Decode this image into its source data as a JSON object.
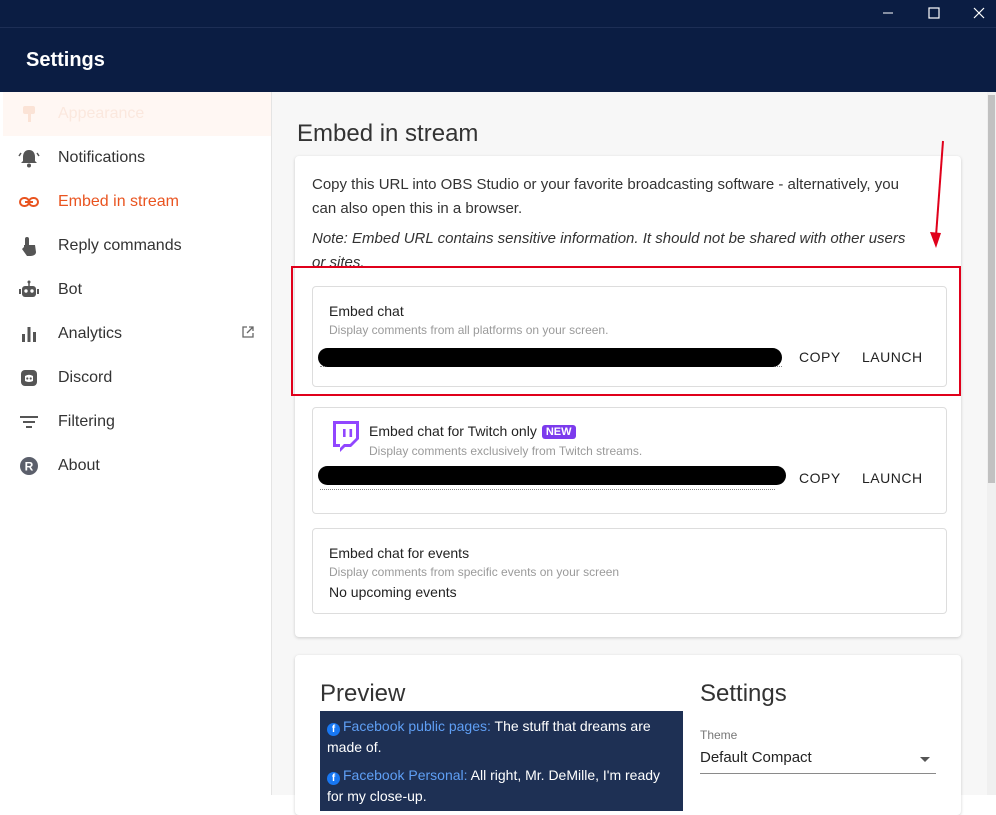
{
  "window": {
    "title": "Settings",
    "controls": [
      "minimize-icon",
      "maximize-icon",
      "close-icon"
    ]
  },
  "sidebar": {
    "items": [
      {
        "label": "Appearance",
        "icon": "paint-icon",
        "state": "faded"
      },
      {
        "label": "Notifications",
        "icon": "bell-icon"
      },
      {
        "label": "Embed in stream",
        "icon": "link-icon",
        "state": "active"
      },
      {
        "label": "Reply commands",
        "icon": "hand-pointer-icon"
      },
      {
        "label": "Bot",
        "icon": "robot-icon"
      },
      {
        "label": "Analytics",
        "icon": "bar-chart-icon",
        "external": true
      },
      {
        "label": "Discord",
        "icon": "discord-icon"
      },
      {
        "label": "Filtering",
        "icon": "filter-icon"
      },
      {
        "label": "About",
        "icon": "restream-logo-icon"
      }
    ]
  },
  "main": {
    "title": "Embed in stream",
    "intro": "Copy this URL into OBS Studio or your favorite broadcasting software - alternatively, you can also open this in a browser.",
    "note": "Note: Embed URL contains sensitive information. It should not be shared with other users or sites.",
    "embeds": [
      {
        "title": "Embed chat",
        "description": "Display comments from all platforms on your screen.",
        "copy_label": "COPY",
        "launch_label": "LAUNCH"
      },
      {
        "title": "Embed chat for Twitch only",
        "badge": "NEW",
        "description": "Display comments exclusively from Twitch streams.",
        "copy_label": "COPY",
        "launch_label": "LAUNCH",
        "icon": "twitch-icon"
      },
      {
        "title": "Embed chat for events",
        "description": "Display comments from specific events on your screen",
        "value": "No upcoming events"
      }
    ],
    "preview": {
      "title": "Preview",
      "messages": [
        {
          "source": "Facebook public pages:",
          "text": "The stuff that dreams are made of."
        },
        {
          "source": "Facebook Personal:",
          "text": "All right, Mr. DeMille, I'm ready for my close-up."
        }
      ]
    },
    "settings": {
      "title": "Settings",
      "theme_label": "Theme",
      "theme_value": "Default Compact"
    }
  },
  "colors": {
    "header_bg": "#0b1d43",
    "accent": "#e95420",
    "highlight": "#e0001b",
    "twitch": "#9146ff",
    "new_badge": "#7c3bed"
  }
}
